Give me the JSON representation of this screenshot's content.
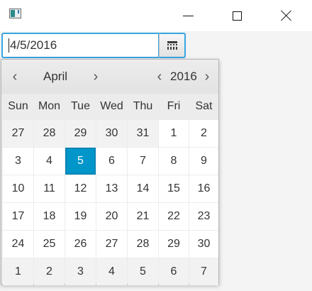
{
  "window": {
    "icon": "app-window-icon",
    "controls": [
      "minimize-icon",
      "maximize-icon",
      "close-icon"
    ]
  },
  "date_field": {
    "value": "4/5/2016",
    "button_icon": "calendar-icon"
  },
  "calendar": {
    "month": "April",
    "year": "2016",
    "prev_month_icon": "‹",
    "next_month_icon": "›",
    "prev_year_icon": "‹",
    "next_year_icon": "›",
    "weekdays": [
      "Sun",
      "Mon",
      "Tue",
      "Wed",
      "Thu",
      "Fri",
      "Sat"
    ],
    "weeks": [
      [
        "27",
        "28",
        "29",
        "30",
        "31",
        "1",
        "2"
      ],
      [
        "3",
        "4",
        "5",
        "6",
        "7",
        "8",
        "9"
      ],
      [
        "10",
        "11",
        "12",
        "13",
        "14",
        "15",
        "16"
      ],
      [
        "17",
        "18",
        "19",
        "20",
        "21",
        "22",
        "23"
      ],
      [
        "24",
        "25",
        "26",
        "27",
        "28",
        "29",
        "30"
      ],
      [
        "1",
        "2",
        "3",
        "4",
        "5",
        "6",
        "7"
      ]
    ],
    "selected_day": "5",
    "accent_color": "#0096c9",
    "focus_color": "#39a6e0"
  }
}
